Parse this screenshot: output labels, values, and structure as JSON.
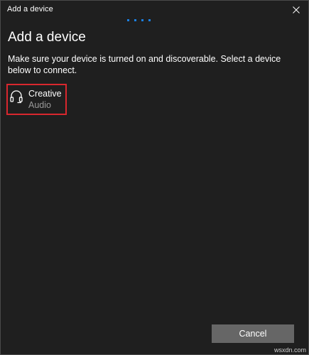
{
  "window": {
    "title": "Add a device"
  },
  "main": {
    "heading": "Add a device",
    "instructions": "Make sure your device is turned on and discoverable. Select a device below to connect."
  },
  "devices": [
    {
      "name": "Creative",
      "type": "Audio",
      "icon": "headphones-icon"
    }
  ],
  "footer": {
    "cancel_label": "Cancel"
  },
  "watermark": "wsxdn.com",
  "colors": {
    "background": "#1f1f1f",
    "accent": "#1b7fe0",
    "highlight_border": "#d9272e",
    "button": "#666666",
    "secondary_text": "#9a9a9a"
  }
}
